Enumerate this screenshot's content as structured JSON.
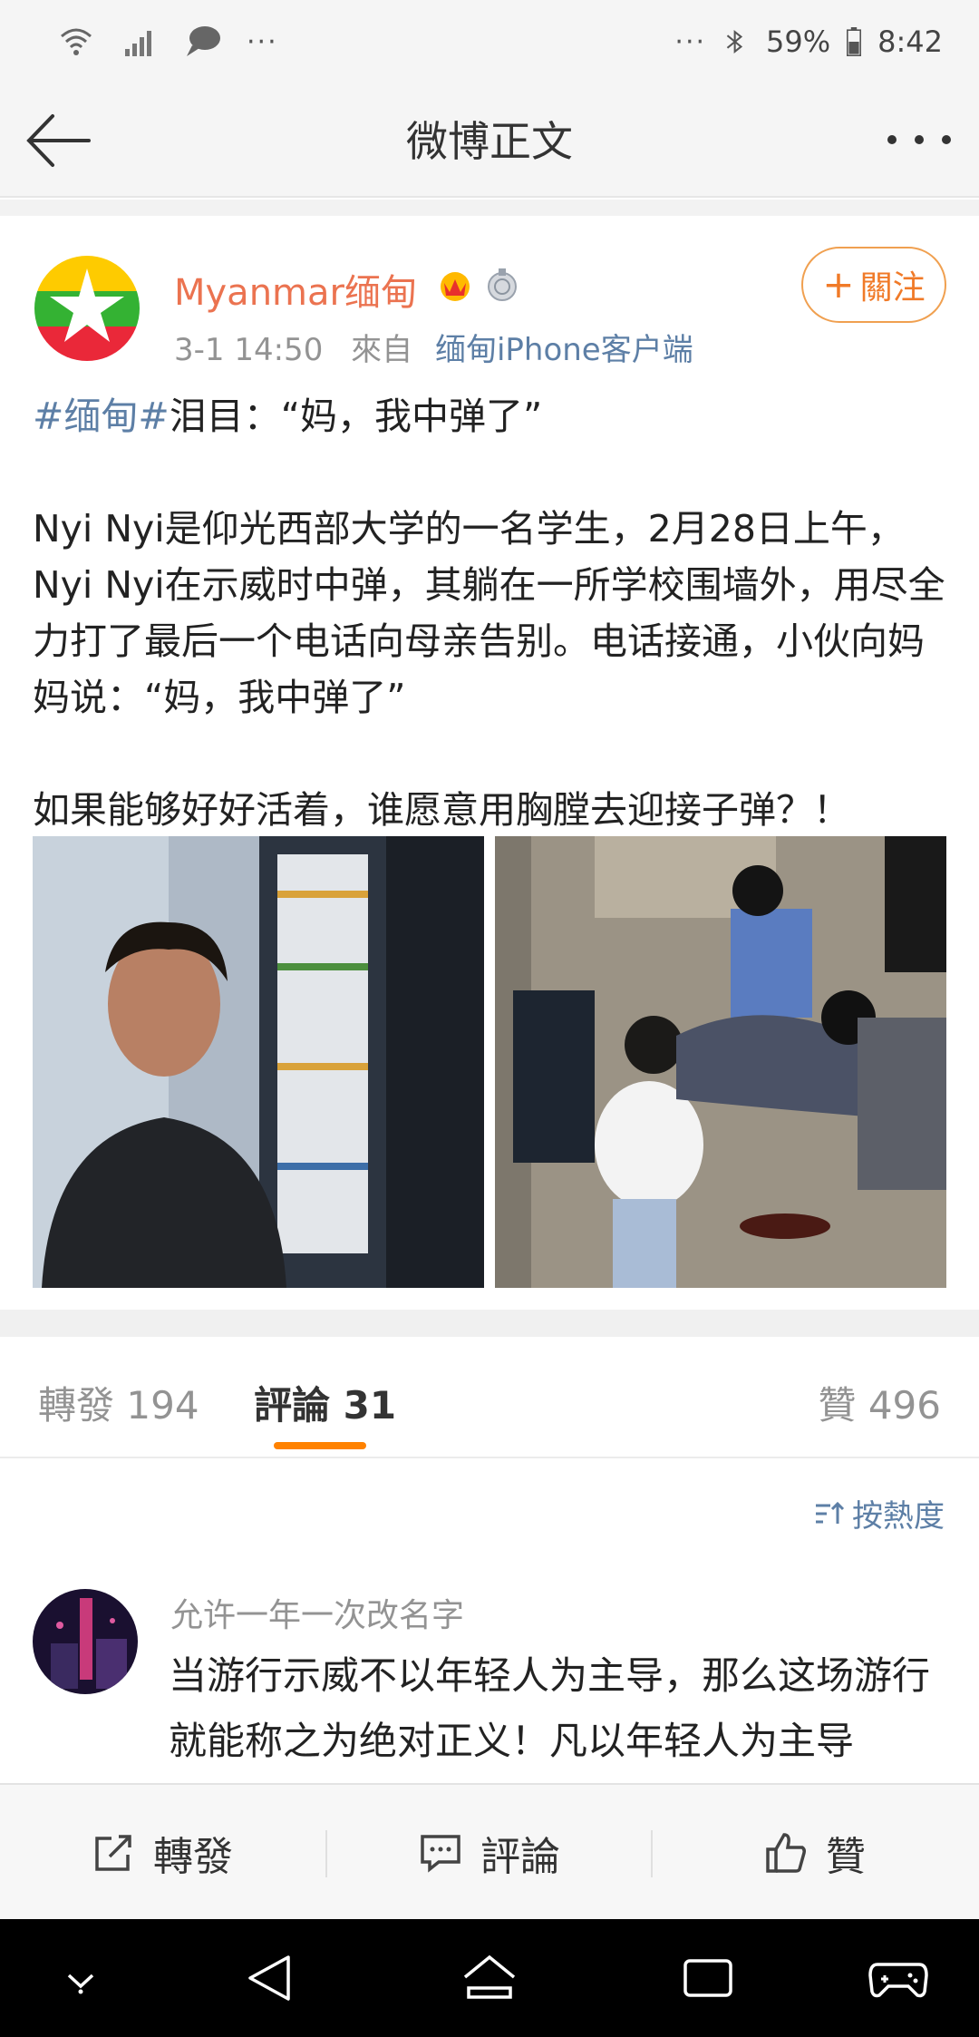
{
  "status_bar": {
    "battery": "59%",
    "time": "8:42",
    "left_more": "···",
    "right_more": "···"
  },
  "nav": {
    "title": "微博正文"
  },
  "post": {
    "username": "Myanmar缅甸",
    "time": "3-1 14:50",
    "source_prefix": "來自",
    "source": "缅甸iPhone客户端",
    "follow_label": "關注",
    "hashtag": "#缅甸#",
    "headline": "泪目：“妈，我中弹了”",
    "paragraph1": "Nyi Nyi是仰光西部大学的一名学生，2月28日上午，Nyi Nyi在示威时中弹，其躺在一所学校围墙外，用尽全力打了最后一个电话向母亲告别。电话接通，小伙向妈妈说：“妈，我中弹了”",
    "paragraph2": "如果能够好好活着，谁愿意用胸膛去迎接子弹？！"
  },
  "tabs": {
    "repost_label": "轉發",
    "repost_count": "194",
    "comment_label": "評論",
    "comment_count": "31",
    "like_label": "贊",
    "like_count": "496"
  },
  "sort_label": "按熱度",
  "comment": {
    "username": "允许一年一次改名字",
    "text": "当游行示威不以年轻人为主导，那么这场游行就能称之为绝对正义！凡以年轻人为主导"
  },
  "actions": {
    "repost": "轉發",
    "comment": "評論",
    "like": "贊"
  },
  "colors": {
    "username": "#eb7350",
    "link": "#5d7fa6",
    "accent": "#ff8200"
  },
  "icons": [
    "wifi-icon",
    "signal-icon",
    "chat-bubble-icon",
    "bluetooth-icon",
    "battery-icon",
    "back-arrow-icon",
    "more-icon",
    "crown-badge-icon",
    "medal-badge-icon",
    "sort-icon",
    "repost-icon",
    "comment-icon",
    "like-icon",
    "nav-down-icon",
    "nav-back-icon",
    "nav-home-icon",
    "nav-recents-icon",
    "game-icon"
  ]
}
